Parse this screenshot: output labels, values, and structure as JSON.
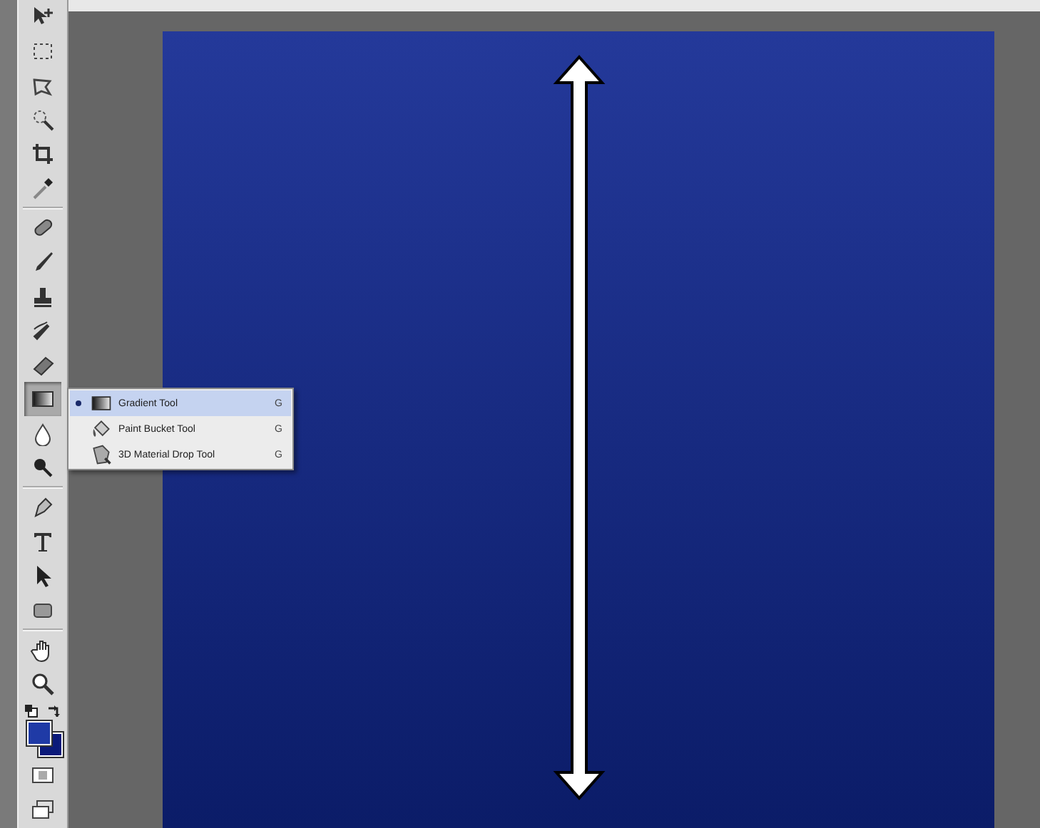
{
  "tool_groups": [
    [
      {
        "kind": "move",
        "selected": false
      },
      {
        "kind": "marquee",
        "selected": false
      },
      {
        "kind": "lasso",
        "selected": false
      },
      {
        "kind": "quick-select",
        "selected": false
      },
      {
        "kind": "crop",
        "selected": false
      },
      {
        "kind": "eyedropper",
        "selected": false
      }
    ],
    [
      {
        "kind": "healing",
        "selected": false
      },
      {
        "kind": "brush",
        "selected": false
      },
      {
        "kind": "stamp",
        "selected": false
      },
      {
        "kind": "history-brush",
        "selected": false
      },
      {
        "kind": "eraser",
        "selected": false
      },
      {
        "kind": "gradient",
        "selected": true
      },
      {
        "kind": "blur",
        "selected": false
      },
      {
        "kind": "dodge",
        "selected": false
      }
    ],
    [
      {
        "kind": "pen",
        "selected": false
      },
      {
        "kind": "type",
        "selected": false
      },
      {
        "kind": "path-select",
        "selected": false
      },
      {
        "kind": "shape",
        "selected": false
      }
    ],
    [
      {
        "kind": "hand",
        "selected": false
      },
      {
        "kind": "zoom",
        "selected": false
      }
    ]
  ],
  "color_swatches": [
    {
      "kind": "foreground",
      "color": "#1f3aa6"
    },
    {
      "kind": "background",
      "color": "#0b1a7a"
    }
  ],
  "flyout": [
    {
      "kind": "gradient",
      "label": "Gradient Tool",
      "shortcut": "G",
      "selected": true
    },
    {
      "kind": "bucket",
      "label": "Paint Bucket Tool",
      "shortcut": "G",
      "selected": false
    },
    {
      "kind": "material",
      "label": "3D Material Drop Tool",
      "shortcut": "G",
      "selected": false
    }
  ]
}
